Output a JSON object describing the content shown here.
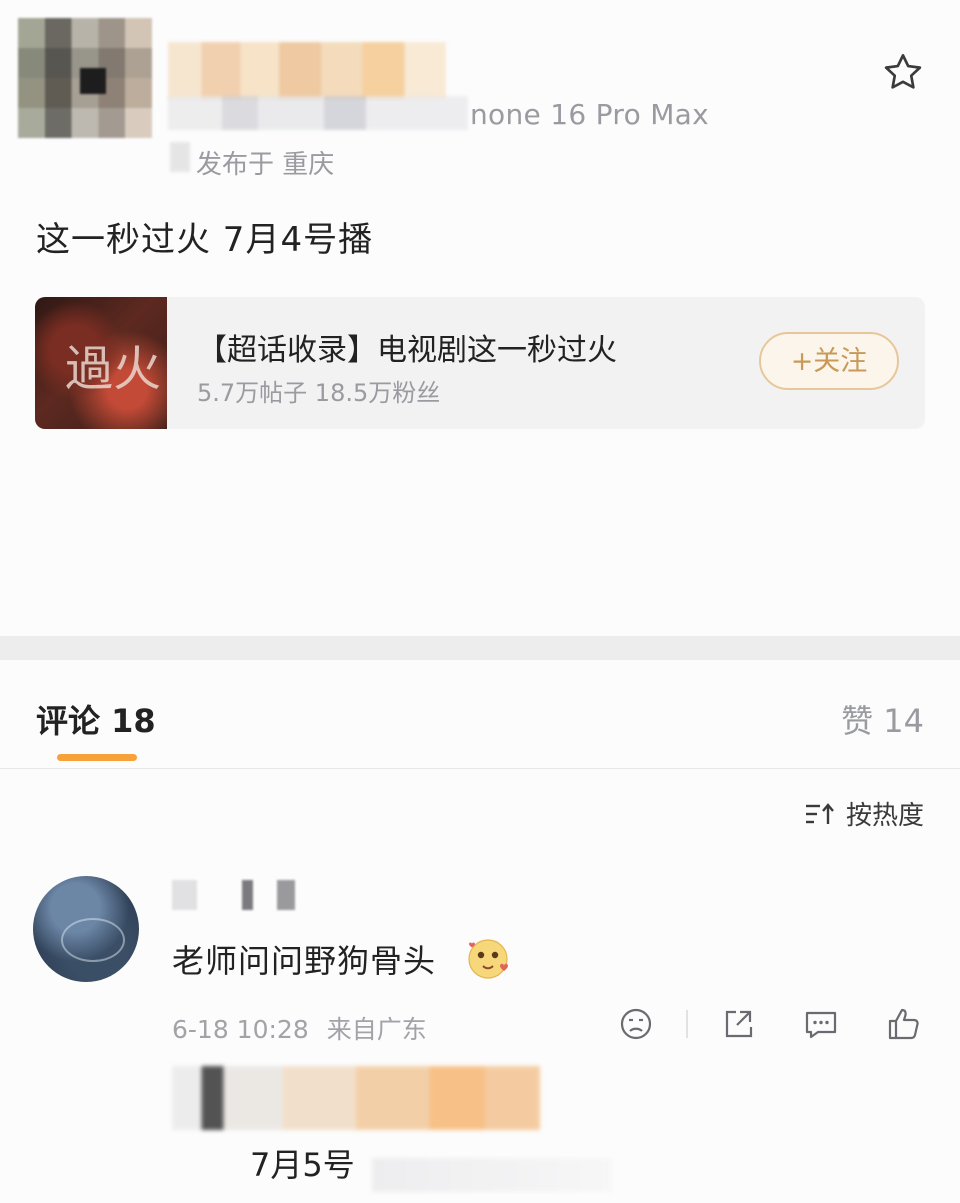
{
  "post": {
    "device_text": "none 16 Pro Max",
    "published_text": "发布于 重庆",
    "content": "这一秒过火 7月4号播"
  },
  "topic_card": {
    "cover_glyph": "過火",
    "title": "【超话收录】电视剧这一秒过火",
    "meta": "5.7万帖子 18.5万粉丝",
    "follow_label": "+关注"
  },
  "comments_header": {
    "tab_label": "评论 18",
    "likes_label": "赞 14",
    "sort_label": "按热度"
  },
  "comment": {
    "text": "老师问问野狗骨头",
    "time": "6-18 10:28",
    "location": "来自广东",
    "reply_text": "7月5号"
  },
  "colors": {
    "accent": "#f7a13a",
    "follow_border": "#e7c79a",
    "follow_text": "#c89a56",
    "muted_text": "#9a9aa1"
  },
  "icons": [
    "star-icon",
    "sort-icon",
    "emoji-icon",
    "dislike-icon",
    "share-icon",
    "comment-icon",
    "like-icon"
  ]
}
